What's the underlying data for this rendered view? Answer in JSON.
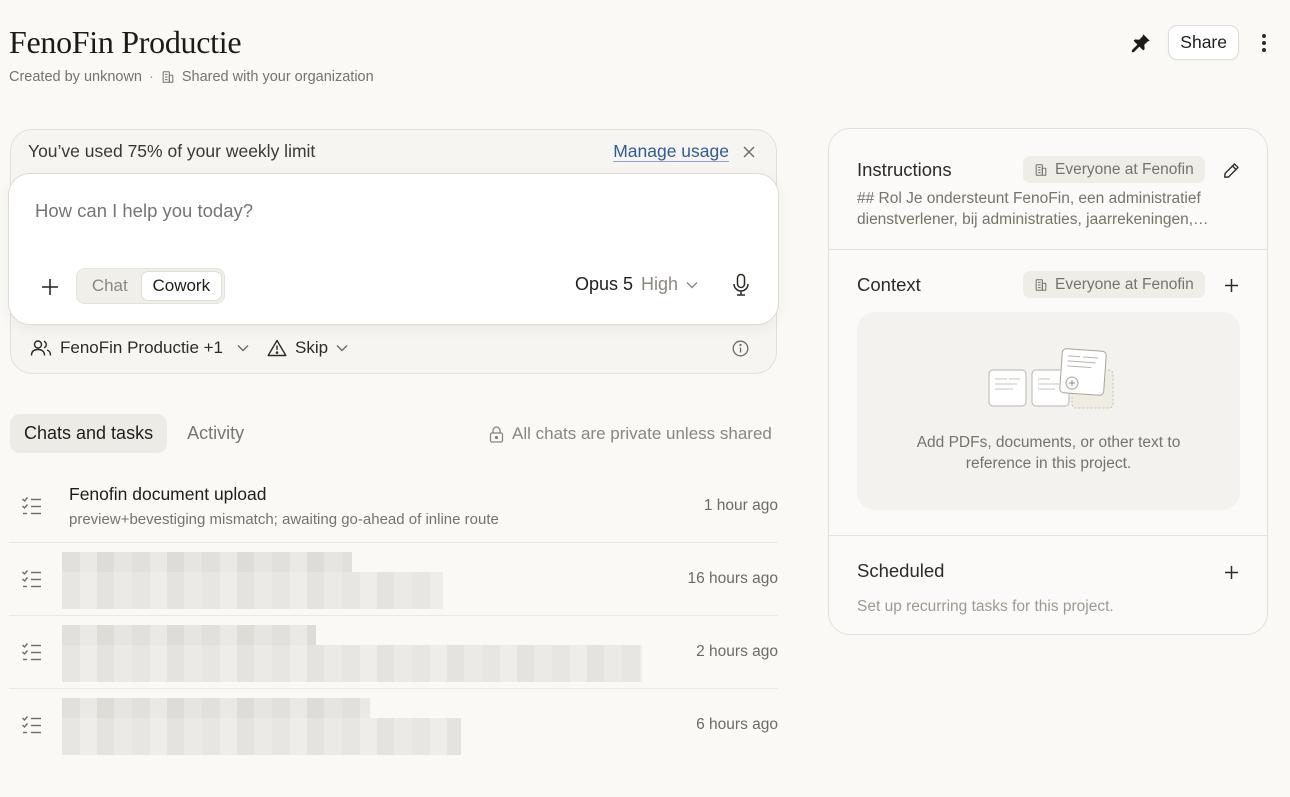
{
  "header": {
    "title": "FenoFin Productie",
    "created_by": "Created by unknown",
    "separator": "·",
    "shared_with": "Shared with your organization",
    "share_label": "Share"
  },
  "usage": {
    "message": "You’ve used 75% of your weekly limit",
    "manage_label": "Manage usage"
  },
  "composer": {
    "placeholder": "How can I help you today?",
    "modes": [
      "Chat",
      "Cowork"
    ],
    "active_mode": "Cowork",
    "model": "Opus 5",
    "effort": "High",
    "project_label": "FenoFin Productie +1",
    "permission_label": "Skip"
  },
  "tabs": {
    "items": [
      "Chats and tasks",
      "Activity"
    ],
    "active": "Chats and tasks",
    "privacy_note": "All chats are private unless shared"
  },
  "tasks": [
    {
      "title": "Fenofin document upload",
      "subtitle": "preview+bevestiging mismatch; awaiting go-ahead of inline route",
      "time": "1 hour ago"
    },
    {
      "title": "",
      "subtitle": "",
      "time": "16 hours ago"
    },
    {
      "title": "",
      "subtitle": "",
      "time": "2 hours ago"
    },
    {
      "title": "",
      "subtitle": "",
      "time": "6 hours ago"
    }
  ],
  "panel": {
    "instructions": {
      "title": "Instructions",
      "scope": "Everyone at Fenofin",
      "text_line1": "## Rol Je ondersteunt FenoFin, een administratief",
      "text_line2": "dienstverlener, bij administraties, jaarrekeningen,…"
    },
    "context": {
      "title": "Context",
      "scope": "Everyone at Fenofin",
      "empty_line1": "Add PDFs, documents, or other text to",
      "empty_line2": "reference in this project."
    },
    "scheduled": {
      "title": "Scheduled",
      "subtitle": "Set up recurring tasks for this project."
    }
  },
  "colors": {
    "background": "#faf9f6",
    "link": "#2e5b9c",
    "muted": "#77736b"
  }
}
